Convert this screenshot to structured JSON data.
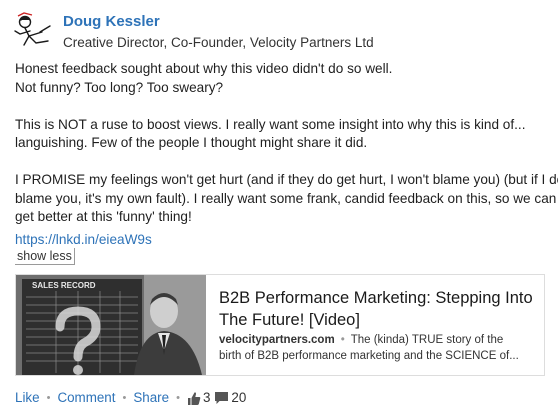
{
  "author": {
    "name": "Doug Kessler",
    "headline": "Creative Director, Co-Founder, Velocity Partners Ltd"
  },
  "post": {
    "paragraphs": [
      [
        "Honest feedback sought about why this video didn't do so well.",
        "Not funny? Too long? Too sweary?"
      ],
      [
        "This is NOT a ruse to boost views. I really want some insight into why this is kind of...",
        "languishing. Few of the people I thought might share it did."
      ],
      [
        "I PROMISE my feelings won't get hurt (and if they do get hurt, I won't blame you) (but if I do",
        "blame you, it's my own fault). I really want some frank, candid feedback on this, so we can",
        "get better at this 'funny' thing!"
      ]
    ],
    "link": "https://lnkd.in/eieaW9s",
    "show_less": "show less"
  },
  "article": {
    "title": "B2B Performance Marketing: Stepping Into The Future! [Video]",
    "source": "velocitypartners.com",
    "separator": "•",
    "description_line1": "The (kinda) TRUE story of the",
    "description_line2": "birth of B2B performance marketing and the SCIENCE of...",
    "thumbnail_board_label": "SALES RECORD"
  },
  "actions": {
    "like": "Like",
    "comment": "Comment",
    "share": "Share",
    "separator": "•",
    "likes_count": "3",
    "comments_count": "20"
  },
  "colors": {
    "link": "#2e73b8",
    "text": "#1f1f1f",
    "muted": "#999999"
  },
  "icons": {
    "avatar": "avatar-illustration",
    "like_count": "thumbs-up-icon",
    "comment_count": "speech-bubble-icon"
  }
}
